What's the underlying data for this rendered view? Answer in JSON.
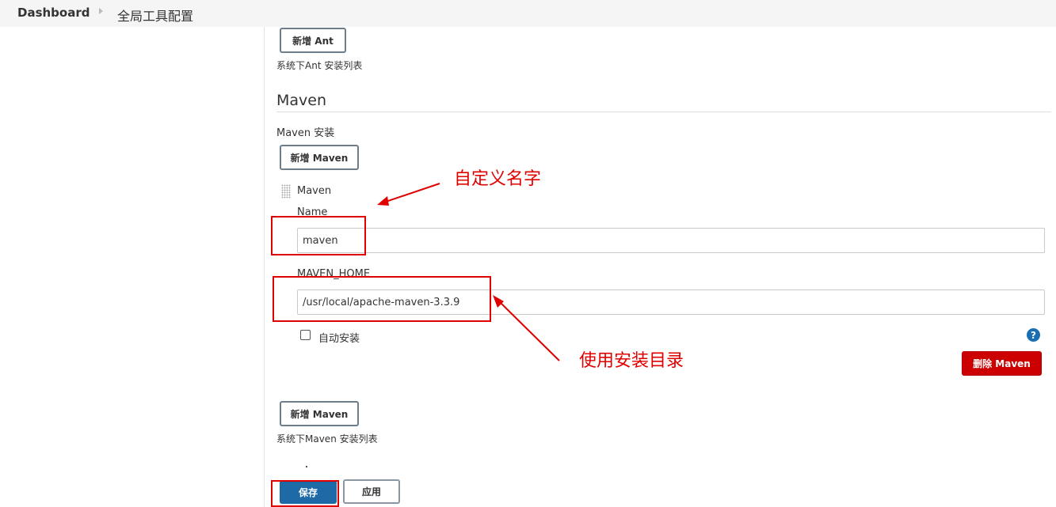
{
  "breadcrumb": {
    "home": "Dashboard",
    "current": "全局工具配置"
  },
  "ant": {
    "add_button": "新增 Ant",
    "list_caption": "系统下Ant 安装列表"
  },
  "maven": {
    "section_title": "Maven",
    "installations_label": "Maven 安装",
    "add_button": "新增 Maven",
    "installation": {
      "header": "Maven",
      "name_label": "Name",
      "name_value": "maven",
      "home_label": "MAVEN_HOME",
      "home_value": "/usr/local/apache-maven-3.3.9",
      "auto_install_label": "自动安装",
      "auto_install_checked": false,
      "help_glyph": "?",
      "delete_button": "删除 Maven"
    },
    "add_button_bottom": "新增 Maven",
    "list_caption": "系统下Maven 安装列表"
  },
  "footer": {
    "save_button": "保存",
    "apply_button": "应用"
  },
  "annotations": {
    "custom_name": "自定义名字",
    "use_install_dir": "使用安装目录",
    "color": "#e00000"
  },
  "colors": {
    "save_button": "#1e6aa6",
    "delete_button": "#cc0000",
    "help_icon": "#1a6fb3"
  }
}
